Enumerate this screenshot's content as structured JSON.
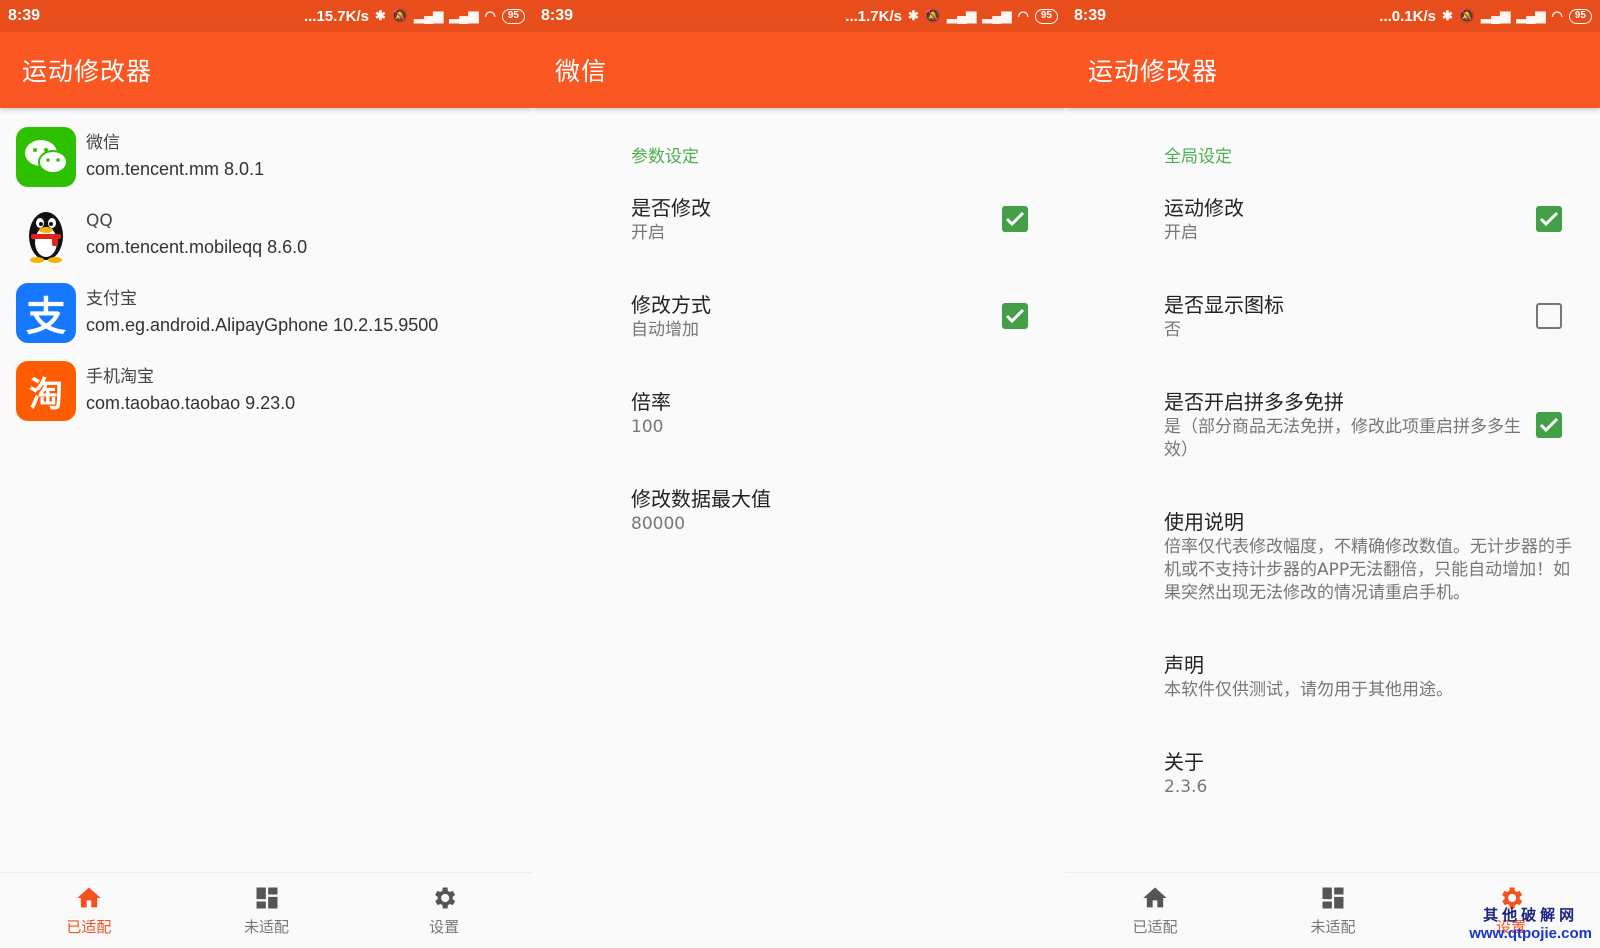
{
  "panels": [
    {
      "status": {
        "time": "8:39",
        "speed": "...15.7K/s",
        "battery": "95"
      },
      "appbar_title": "运动修改器",
      "apps": [
        {
          "name": "微信",
          "package": "com.tencent.mm 8.0.1",
          "icon": "wechat-icon",
          "color": "#2dc100"
        },
        {
          "name": "QQ",
          "package": "com.tencent.mobileqq 8.6.0",
          "icon": "qq-penguin-icon",
          "color": "#000000"
        },
        {
          "name": "支付宝",
          "package": "com.eg.android.AlipayGphone 10.2.15.9500",
          "icon": "alipay-icon",
          "color": "#1677ff",
          "glyph": "支"
        },
        {
          "name": "手机淘宝",
          "package": "com.taobao.taobao 9.23.0",
          "icon": "taobao-icon",
          "color": "#ff5b00",
          "glyph": "淘"
        }
      ],
      "nav": [
        {
          "label": "已适配",
          "icon": "home-icon",
          "active": true
        },
        {
          "label": "未适配",
          "icon": "dashboard-icon",
          "active": false
        },
        {
          "label": "设置",
          "icon": "gear-icon",
          "active": false
        }
      ]
    },
    {
      "status": {
        "time": "8:39",
        "speed": "...1.7K/s",
        "battery": "95"
      },
      "appbar_title": "微信",
      "category": "参数设定",
      "prefs": [
        {
          "title": "是否修改",
          "summary": "开启",
          "checked": true
        },
        {
          "title": "修改方式",
          "summary": "自动增加",
          "checked": true
        },
        {
          "title": "倍率",
          "summary": "100"
        },
        {
          "title": "修改数据最大值",
          "summary": "80000"
        }
      ]
    },
    {
      "status": {
        "time": "8:39",
        "speed": "...0.1K/s",
        "battery": "95"
      },
      "appbar_title": "运动修改器",
      "category": "全局设定",
      "prefs": [
        {
          "title": "运动修改",
          "summary": "开启",
          "checked": true
        },
        {
          "title": "是否显示图标",
          "summary": "否",
          "checked": false
        },
        {
          "title": "是否开启拼多多免拼",
          "summary": "是（部分商品无法免拼，修改此项重启拼多多生效）",
          "checked": true
        },
        {
          "title": "使用说明",
          "summary": "倍率仅代表修改幅度，不精确修改数值。无计步器的手机或不支持计步器的APP无法翻倍，只能自动增加！如果突然出现无法修改的情况请重启手机。"
        },
        {
          "title": "声明",
          "summary": "本软件仅供测试，请勿用于其他用途。"
        },
        {
          "title": "关于",
          "summary": "2.3.6"
        }
      ],
      "nav": [
        {
          "label": "已适配",
          "icon": "home-icon",
          "active": false
        },
        {
          "label": "未适配",
          "icon": "dashboard-icon",
          "active": false
        },
        {
          "label": "设置",
          "icon": "gear-icon",
          "active": true
        }
      ]
    }
  ],
  "watermark": {
    "line1": "其他破解网",
    "line2": "www.qtpojie.com"
  },
  "colors": {
    "statusbar": "#e84e1b",
    "appbar": "#fb5722",
    "accent": "#4caf50",
    "nav_active": "#f4511e",
    "checkbox": "#43a047"
  }
}
